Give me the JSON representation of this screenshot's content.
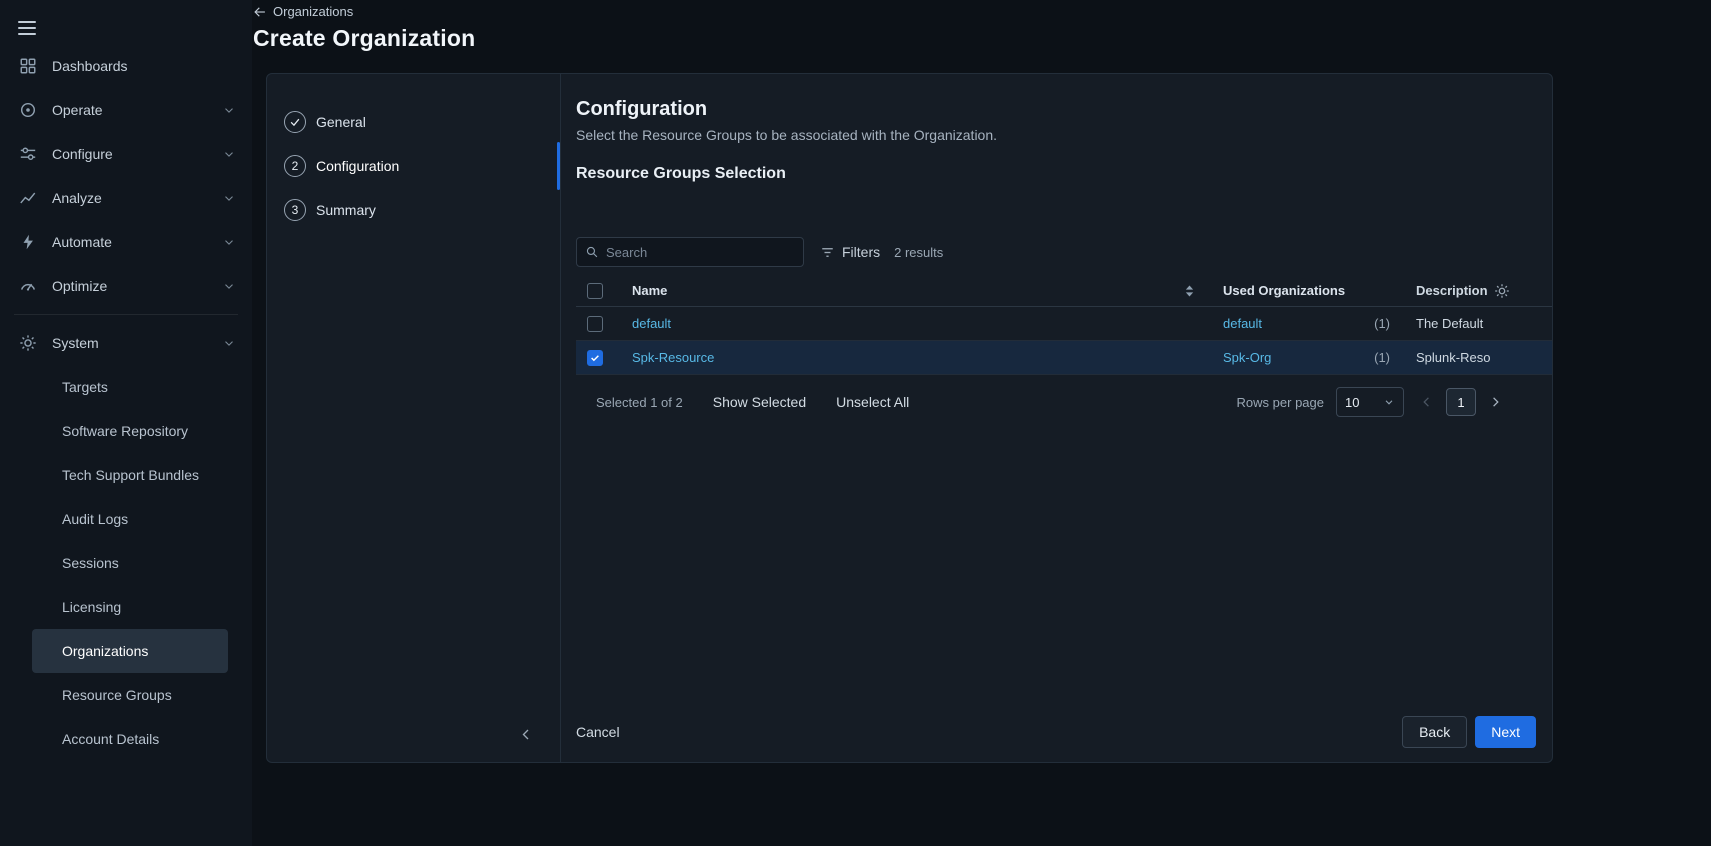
{
  "header": {
    "back_label": "Organizations",
    "title": "Create Organization"
  },
  "sidebar": {
    "items": [
      {
        "label": "Dashboards",
        "icon": "dashboards-icon"
      },
      {
        "label": "Operate",
        "icon": "operate-icon"
      },
      {
        "label": "Configure",
        "icon": "configure-icon"
      },
      {
        "label": "Analyze",
        "icon": "analyze-icon"
      },
      {
        "label": "Automate",
        "icon": "automate-icon"
      },
      {
        "label": "Optimize",
        "icon": "optimize-icon"
      }
    ],
    "system": {
      "label": "System",
      "icon": "system-gear-icon",
      "items": [
        {
          "label": "Targets"
        },
        {
          "label": "Software Repository"
        },
        {
          "label": "Tech Support Bundles"
        },
        {
          "label": "Audit Logs"
        },
        {
          "label": "Sessions"
        },
        {
          "label": "Licensing"
        },
        {
          "label": "Organizations",
          "active": true
        },
        {
          "label": "Resource Groups"
        },
        {
          "label": "Account Details"
        }
      ]
    }
  },
  "wizard": {
    "steps": [
      {
        "label": "General",
        "state": "complete"
      },
      {
        "number": "2",
        "label": "Configuration",
        "state": "active"
      },
      {
        "number": "3",
        "label": "Summary",
        "state": "upcoming"
      }
    ]
  },
  "content": {
    "title": "Configuration",
    "subtitle": "Select the Resource Groups to be associated with the Organization.",
    "section_title": "Resource Groups Selection",
    "search": {
      "placeholder": "Search"
    },
    "filters_label": "Filters",
    "results_text": "2 results",
    "table": {
      "columns": {
        "name": "Name",
        "used_organizations": "Used Organizations",
        "description": "Description"
      },
      "rows": [
        {
          "name": "default",
          "used_org": "default",
          "used_count": "(1)",
          "description": "The Default",
          "selected": false
        },
        {
          "name": "Spk-Resource",
          "used_org": "Spk-Org",
          "used_count": "(1)",
          "description": "Splunk-Reso",
          "selected": true
        }
      ]
    },
    "selection": {
      "summary": "Selected 1 of 2",
      "show_selected_label": "Show Selected",
      "unselect_all_label": "Unselect All"
    },
    "pagination": {
      "rows_per_page_label": "Rows per page",
      "rows_per_page_value": "10",
      "page": "1"
    }
  },
  "footer": {
    "cancel_label": "Cancel",
    "back_label": "Back",
    "next_label": "Next"
  },
  "colors": {
    "accent_blue": "#1f6ce1",
    "link_blue": "#58b9e6",
    "panel_bg": "#151c25"
  }
}
